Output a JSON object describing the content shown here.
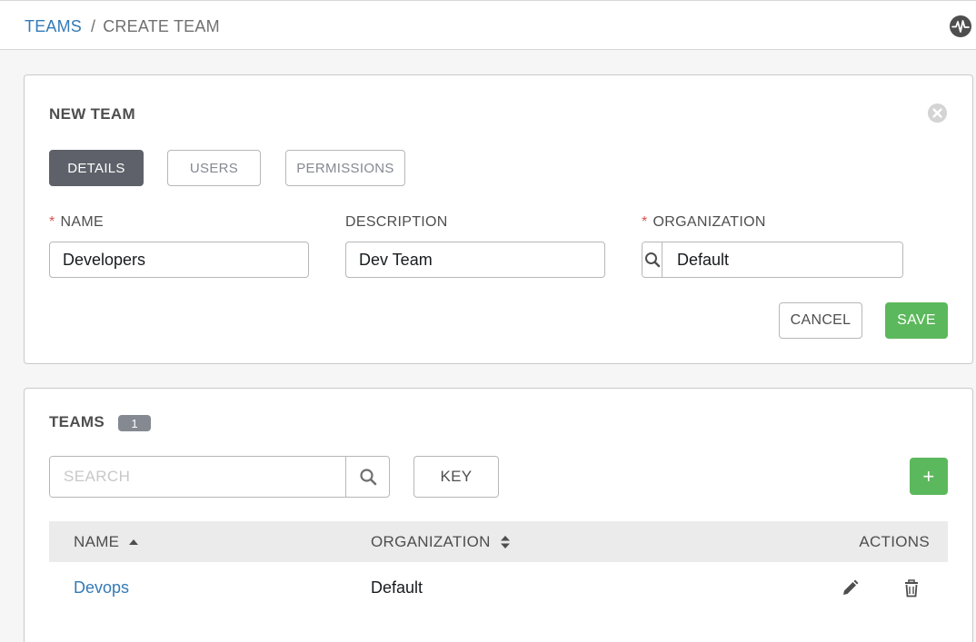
{
  "breadcrumb": {
    "parent": "TEAMS",
    "separator": "/",
    "current": "CREATE TEAM"
  },
  "icons": {
    "activity": "activity-stream-icon",
    "close": "close-circle-icon",
    "search": "search-icon",
    "edit": "pencil-icon",
    "delete": "trash-icon"
  },
  "form": {
    "title": "NEW TEAM",
    "tabs": {
      "details": "DETAILS",
      "users": "USERS",
      "permissions": "PERMISSIONS"
    },
    "fields": {
      "required_mark": "*",
      "name_label": "NAME",
      "name_value": "Developers",
      "description_label": "DESCRIPTION",
      "description_value": "Dev Team",
      "organization_label": "ORGANIZATION",
      "organization_value": "Default"
    },
    "cancel": "CANCEL",
    "save": "SAVE"
  },
  "teams_list": {
    "title": "TEAMS",
    "count": "1",
    "search_placeholder": "SEARCH",
    "key_button": "KEY",
    "add_button": "+",
    "columns": {
      "name": "NAME",
      "organization": "ORGANIZATION",
      "actions": "ACTIONS"
    },
    "rows": [
      {
        "name": "Devops",
        "organization": "Default"
      }
    ]
  },
  "colors": {
    "link": "#337ab7",
    "success": "#5cb85c",
    "active_tab": "#5e6169",
    "required": "#d9534f"
  }
}
